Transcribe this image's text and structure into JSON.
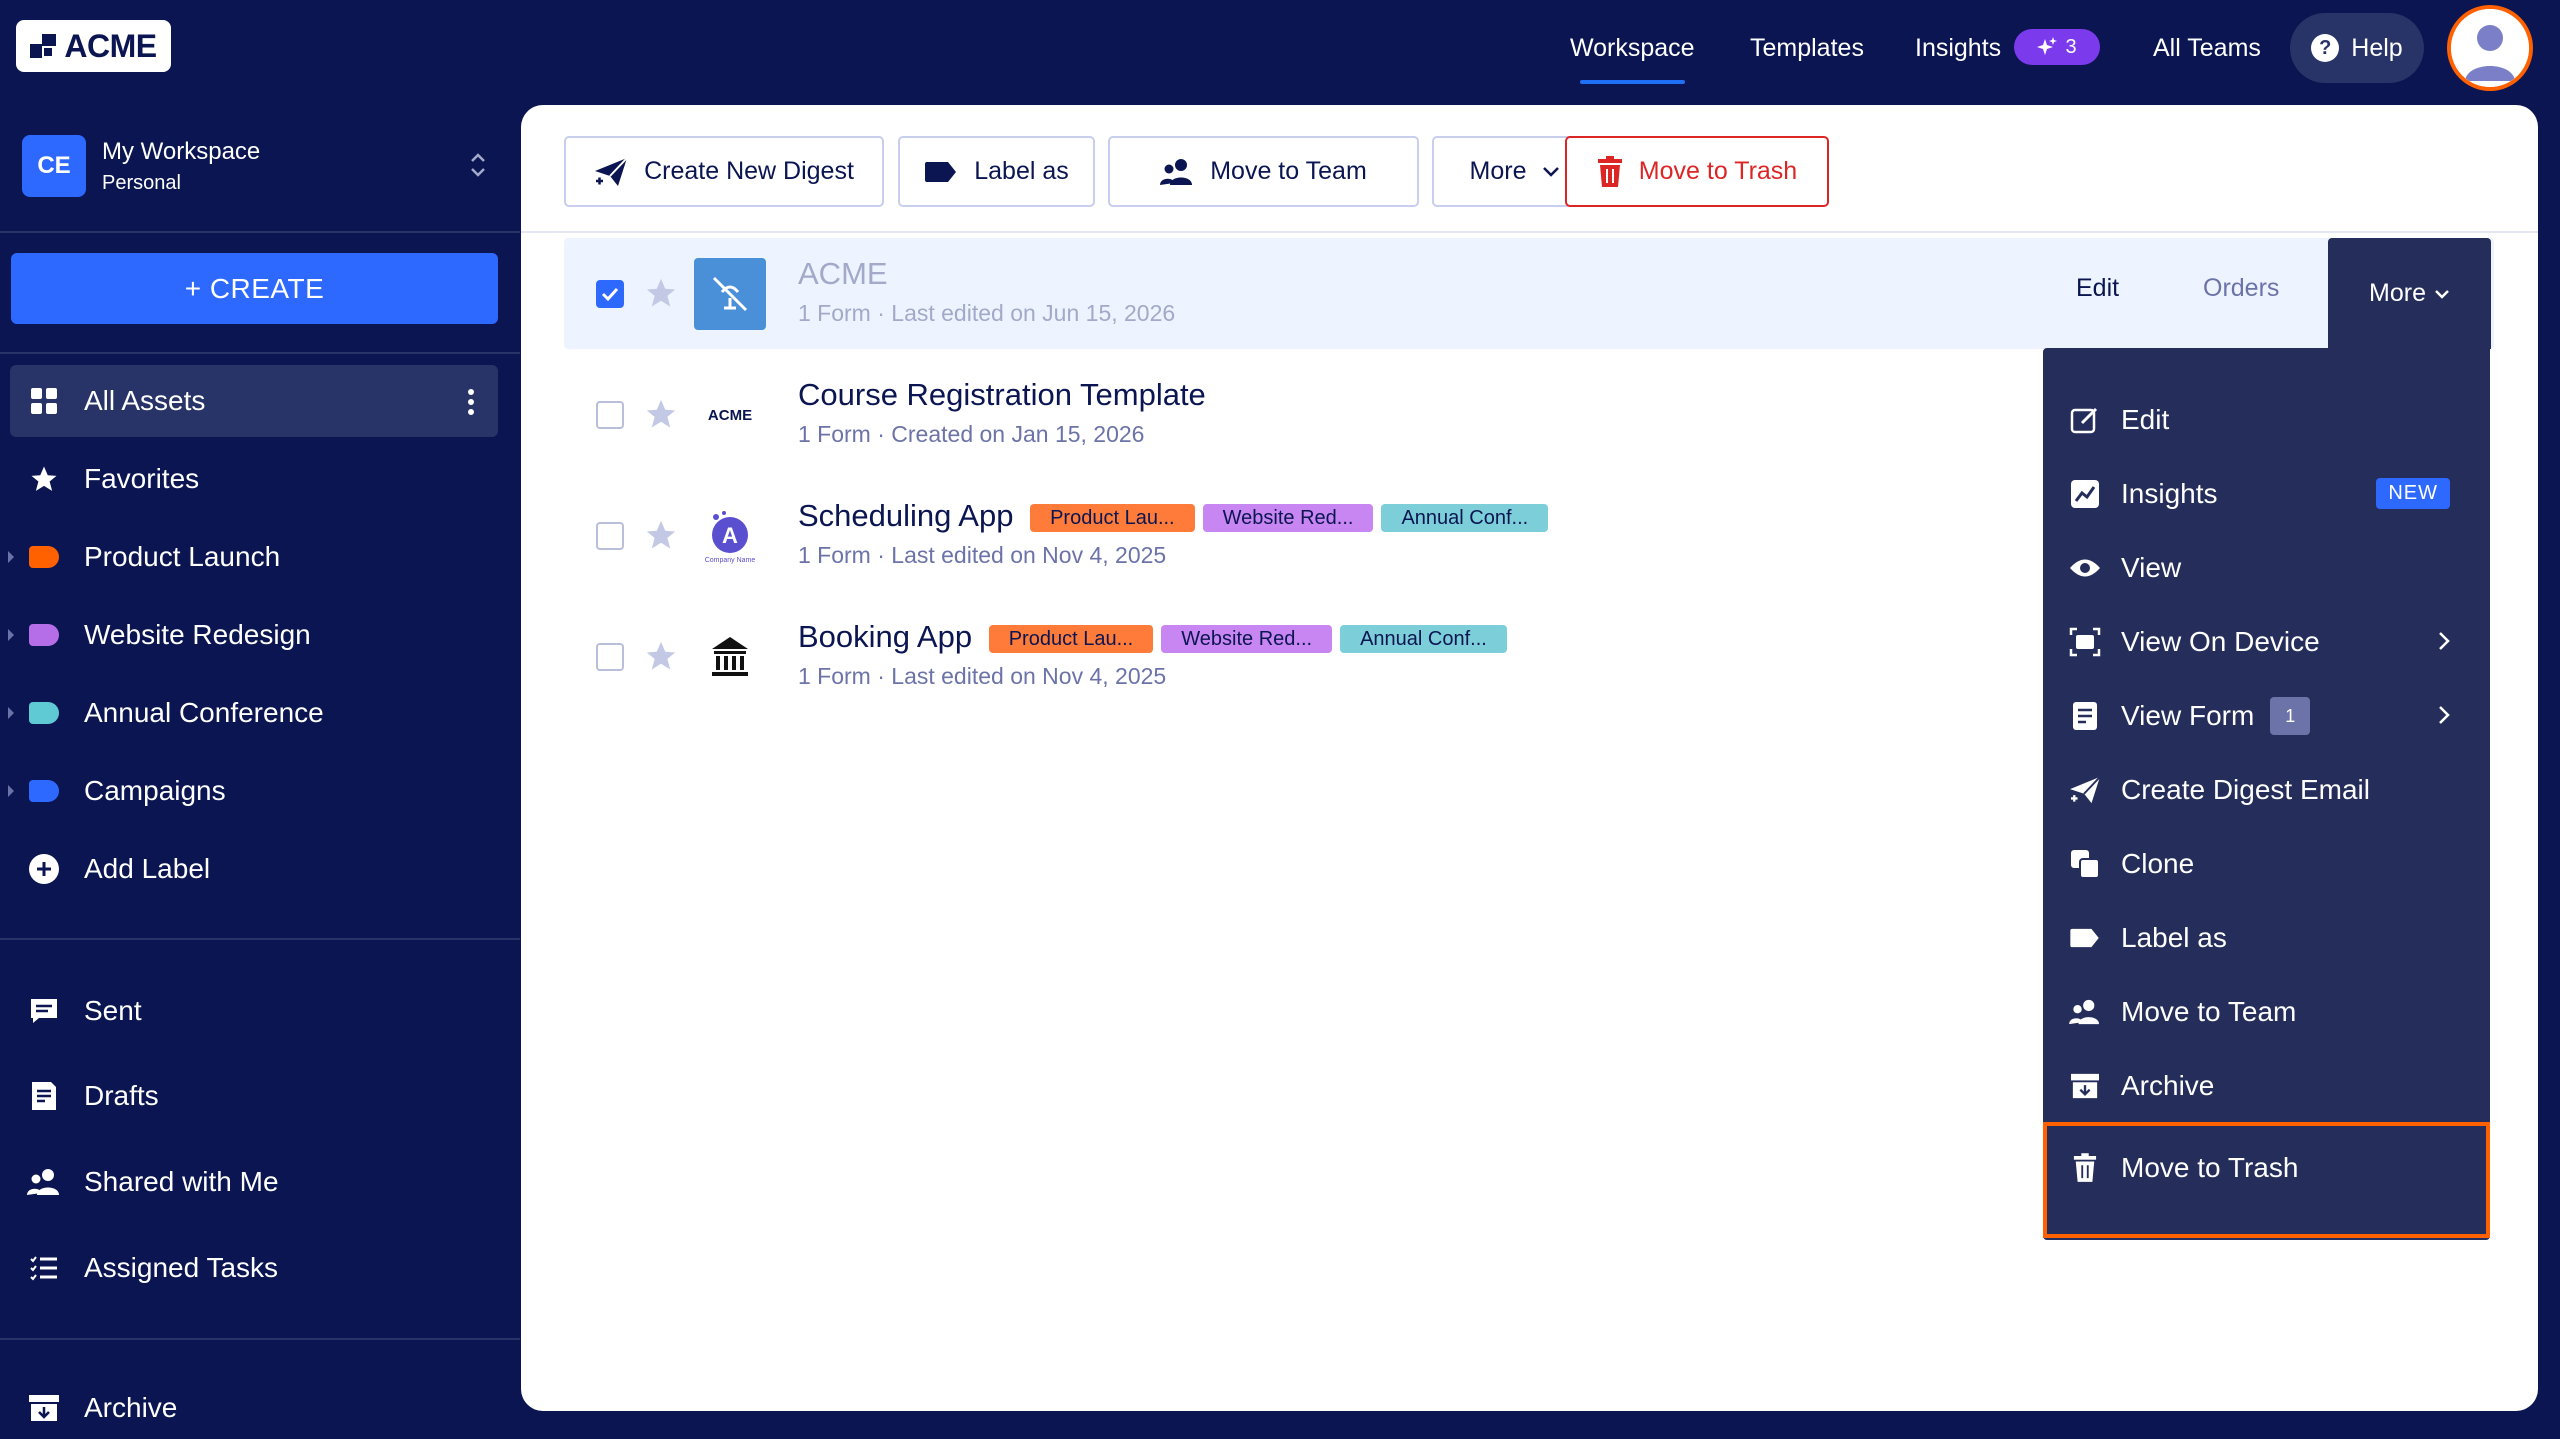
{
  "brand": {
    "logo_text": "ACME"
  },
  "topnav": {
    "workspace": "Workspace",
    "templates": "Templates",
    "insights": "Insights",
    "insights_badge_count": "3",
    "all_teams": "All Teams",
    "help": "Help"
  },
  "sidebar": {
    "workspace_initials": "CE",
    "workspace_name": "My Workspace",
    "workspace_type": "Personal",
    "create_label": "+ CREATE",
    "items": [
      {
        "label": "All Assets",
        "icon": "grid-icon"
      },
      {
        "label": "Favorites",
        "icon": "star-icon"
      },
      {
        "label": "Product Launch",
        "icon": "label-icon",
        "color": "#ff6100"
      },
      {
        "label": "Website Redesign",
        "icon": "label-icon",
        "color": "#b66ee8"
      },
      {
        "label": "Annual Conference",
        "icon": "label-icon",
        "color": "#5fc9d4"
      },
      {
        "label": "Campaigns",
        "icon": "label-icon",
        "color": "#2e69ff"
      },
      {
        "label": "Add Label",
        "icon": "plus-circle-icon"
      }
    ],
    "secondary": [
      {
        "label": "Sent",
        "icon": "message-icon"
      },
      {
        "label": "Drafts",
        "icon": "draft-icon"
      },
      {
        "label": "Shared with Me",
        "icon": "users-icon"
      },
      {
        "label": "Assigned Tasks",
        "icon": "list-icon"
      }
    ],
    "archive": "Archive"
  },
  "toolbar": {
    "create_digest": "Create New Digest",
    "label_as": "Label as",
    "move_to_team": "Move to Team",
    "more": "More",
    "move_to_trash": "Move to Trash"
  },
  "rows": [
    {
      "title": "ACME",
      "subtitle": "1 Form · Last edited on Jun 15, 2026",
      "selected": true,
      "tags": []
    },
    {
      "title": "Course Registration Template",
      "subtitle": "1 Form · Created on Jan 15, 2026",
      "selected": false,
      "tags": [],
      "thumb_text": "ACME"
    },
    {
      "title": "Scheduling App",
      "subtitle": "1 Form · Last edited on Nov 4, 2025",
      "selected": false,
      "thumb_text": "Company Name",
      "tags": [
        {
          "label": "Product Lau...",
          "color": "#ff7b3a"
        },
        {
          "label": "Website Red...",
          "color": "#c886f2"
        },
        {
          "label": "Annual Conf...",
          "color": "#7ccfd8"
        }
      ]
    },
    {
      "title": "Booking App",
      "subtitle": "1 Form · Last edited on Nov 4, 2025",
      "selected": false,
      "tags": [
        {
          "label": "Product Lau...",
          "color": "#ff7b3a"
        },
        {
          "label": "Website Red...",
          "color": "#c886f2"
        },
        {
          "label": "Annual Conf...",
          "color": "#7ccfd8"
        }
      ]
    }
  ],
  "row_actions": {
    "edit": "Edit",
    "orders": "Orders",
    "more": "More"
  },
  "dropdown": {
    "items": [
      {
        "label": "Edit",
        "icon": "edit-icon"
      },
      {
        "label": "Insights",
        "icon": "insights-icon",
        "badge": "NEW"
      },
      {
        "label": "View",
        "icon": "eye-icon"
      },
      {
        "label": "View On Device",
        "icon": "device-icon"
      },
      {
        "label": "View Form",
        "icon": "form-icon",
        "count": "1"
      },
      {
        "label": "Create Digest Email",
        "icon": "send-icon"
      },
      {
        "label": "Clone",
        "icon": "clone-icon"
      },
      {
        "label": "Label as",
        "icon": "label-icon"
      },
      {
        "label": "Move to Team",
        "icon": "users-icon"
      },
      {
        "label": "Archive",
        "icon": "archive-icon"
      },
      {
        "label": "Move to Trash",
        "icon": "trash-icon"
      }
    ]
  },
  "colors": {
    "navy": "#0a1551",
    "accent_blue": "#2e69ff",
    "highlight_orange": "#ff6100",
    "danger_red": "#dc2626"
  }
}
